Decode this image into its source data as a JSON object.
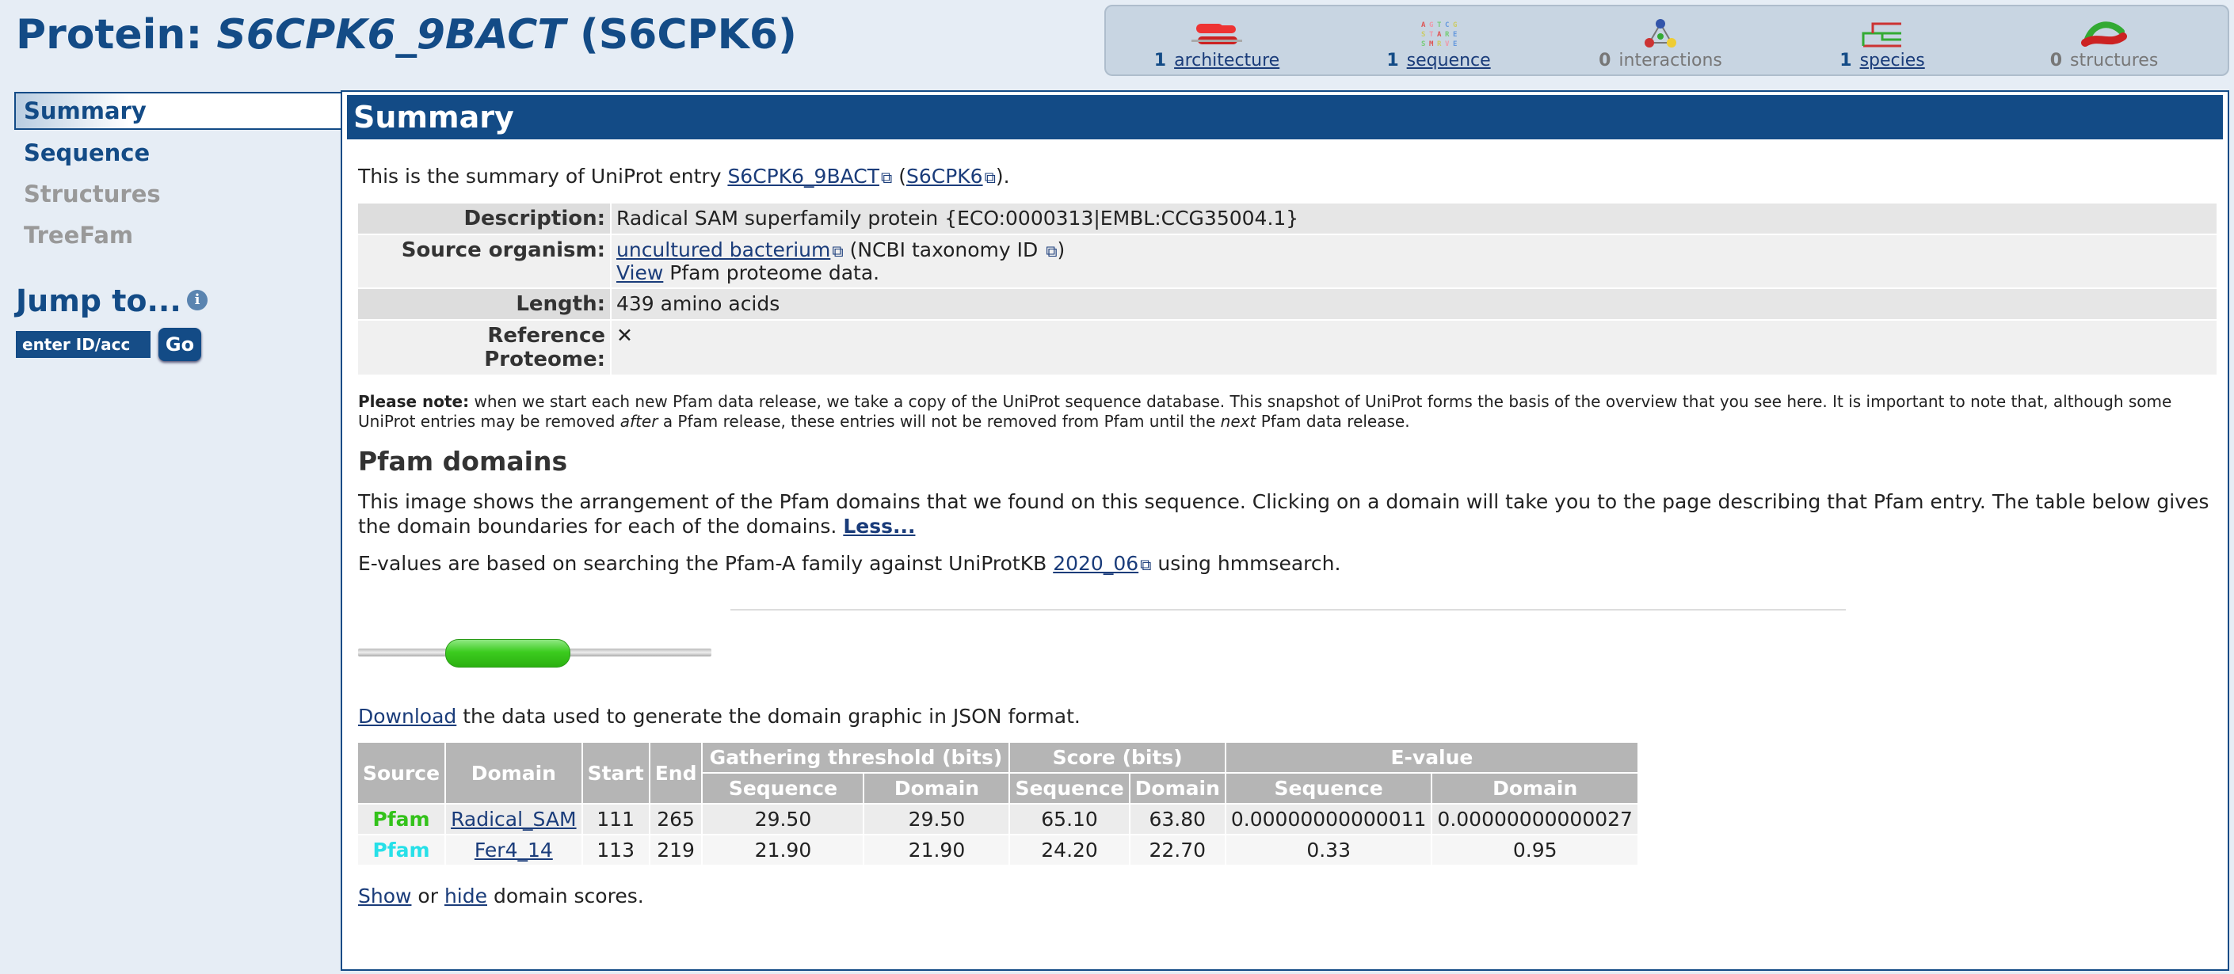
{
  "header": {
    "title_prefix": "Protein:",
    "title_entry": "S6CPK6_9BACT",
    "title_acc": "(S6CPK6)"
  },
  "icon_bar": [
    {
      "count": "1",
      "label": "architecture",
      "icon": "architecture-icon",
      "active": true
    },
    {
      "count": "1",
      "label": "sequence",
      "icon": "sequence-icon",
      "active": true
    },
    {
      "count": "0",
      "label": "interactions",
      "icon": "interactions-icon",
      "active": false
    },
    {
      "count": "1",
      "label": "species",
      "icon": "species-icon",
      "active": true
    },
    {
      "count": "0",
      "label": "structures",
      "icon": "structures-icon",
      "active": false
    }
  ],
  "sidebar": {
    "items": [
      {
        "label": "Summary",
        "state": "active"
      },
      {
        "label": "Sequence",
        "state": "enabled"
      },
      {
        "label": "Structures",
        "state": "disabled"
      },
      {
        "label": "TreeFam",
        "state": "disabled"
      }
    ],
    "jump_title": "Jump to...",
    "jump_info_icon": "i",
    "jump_placeholder": "enter ID/acc",
    "go_label": "Go"
  },
  "summary": {
    "heading": "Summary",
    "intro_text": "This is the summary of UniProt entry",
    "intro_entry": "S6CPK6_9BACT",
    "intro_acc": "S6CPK6",
    "rows": {
      "description_label": "Description:",
      "description_value": "Radical SAM superfamily protein {ECO:0000313|EMBL:CCG35004.1}",
      "organism_label": "Source organism:",
      "organism_link": "uncultured bacterium",
      "organism_taxonomy": "(NCBI taxonomy ID",
      "organism_view_link": "View",
      "organism_view_text": "Pfam proteome data.",
      "length_label": "Length:",
      "length_value": "439 amino acids",
      "refprot_label": "Reference Proteome:",
      "refprot_value": "✕"
    },
    "note_bold": "Please note:",
    "note_text_1": "when we start each new Pfam data release, we take a copy of the UniProt sequence database. This snapshot of UniProt forms the basis of the overview that you see here. It is important to note that, although some UniProt entries may be removed",
    "note_after": "after",
    "note_text_2": "a Pfam release, these entries will not be removed from Pfam until the",
    "note_next": "next",
    "note_text_3": "Pfam data release."
  },
  "pfam_domains": {
    "heading": "Pfam domains",
    "desc": "This image shows the arrangement of the Pfam domains that we found on this sequence. Clicking on a domain will take you to the page describing that Pfam entry. The table below gives the domain boundaries for each of the domains.",
    "less_link": "Less...",
    "evalue_text_1": "E-values are based on searching the Pfam-A family against UniProtKB",
    "evalue_release": "2020_06",
    "evalue_text_2": "using hmmsearch.",
    "download_link": "Download",
    "download_text": "the data used to generate the domain graphic in JSON format.",
    "table": {
      "headers": {
        "source": "Source",
        "domain": "Domain",
        "start": "Start",
        "end": "End",
        "gathering": "Gathering threshold (bits)",
        "score": "Score (bits)",
        "evalue": "E-value",
        "sequence": "Sequence",
        "domain_sub": "Domain"
      },
      "rows": [
        {
          "source": "Pfam",
          "source_color": "#33c21a",
          "domain": "Radical_SAM",
          "start": "111",
          "end": "265",
          "gt_seq": "29.50",
          "gt_dom": "29.50",
          "sc_seq": "65.10",
          "sc_dom": "63.80",
          "ev_seq": "0.00000000000011",
          "ev_dom": "0.00000000000027"
        },
        {
          "source": "Pfam",
          "source_color": "#27e0e8",
          "domain": "Fer4_14",
          "start": "113",
          "end": "219",
          "gt_seq": "21.90",
          "gt_dom": "21.90",
          "sc_seq": "24.20",
          "sc_dom": "22.70",
          "ev_seq": "0.33",
          "ev_dom": "0.95"
        }
      ]
    },
    "show_link": "Show",
    "or_text": "or",
    "hide_link": "hide",
    "scores_text": "domain scores."
  }
}
